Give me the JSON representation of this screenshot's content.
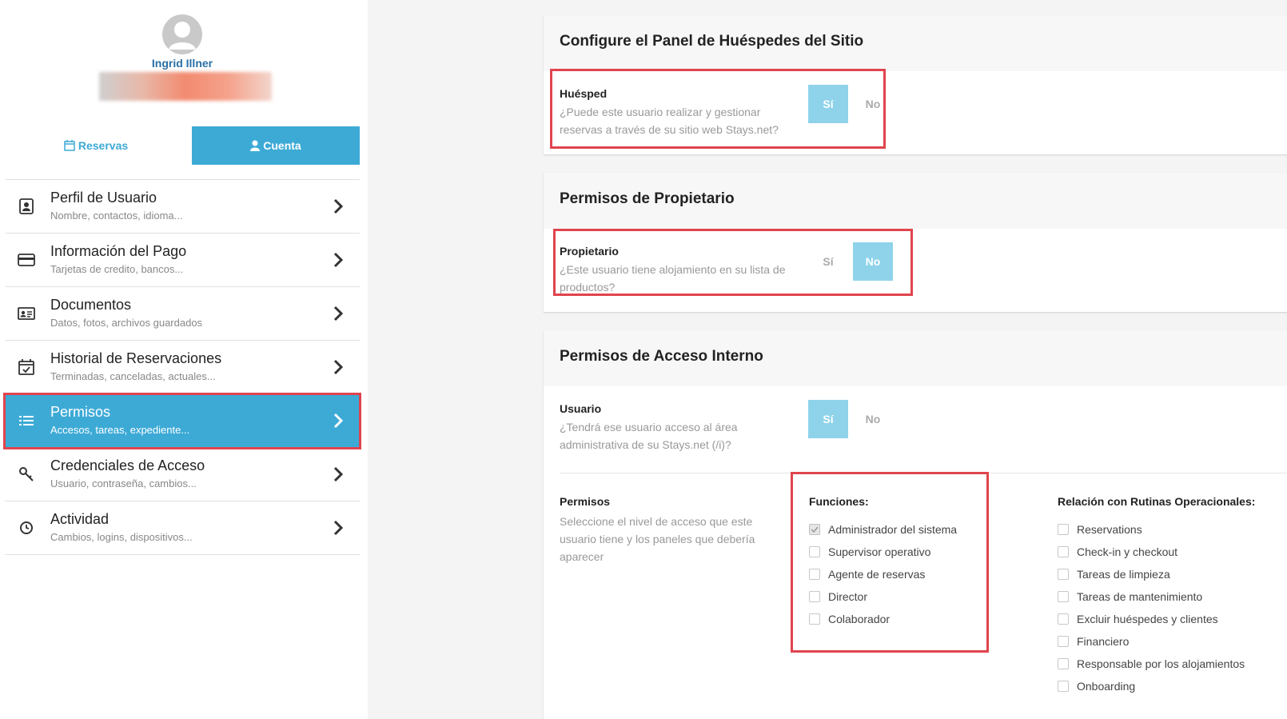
{
  "profile": {
    "name": "Ingrid Illner"
  },
  "tabs": {
    "reservas": "Reservas",
    "cuenta": "Cuenta"
  },
  "menu": [
    {
      "title": "Perfil de Usuario",
      "sub": "Nombre, contactos, idioma..."
    },
    {
      "title": "Información del Pago",
      "sub": "Tarjetas de credito, bancos..."
    },
    {
      "title": "Documentos",
      "sub": "Datos, fotos, archivos guardados"
    },
    {
      "title": "Historial de Reservaciones",
      "sub": "Terminadas, canceladas, actuales..."
    },
    {
      "title": "Permisos",
      "sub": "Accesos, tareas, expediente..."
    },
    {
      "title": "Credenciales de Acceso",
      "sub": "Usuario, contraseña, cambios..."
    },
    {
      "title": "Actividad",
      "sub": "Cambios, logins, dispositivos..."
    }
  ],
  "guest_panel": {
    "title": "Configure el Panel de Huéspedes del Sitio",
    "label": "Huésped",
    "desc": "¿Puede este usuario realizar y gestionar reservas a través de su sitio web Stays.net?",
    "yes": "Sí",
    "no": "No",
    "selected": "yes"
  },
  "owner_panel": {
    "title": "Permisos de Propietario",
    "label": "Propietario",
    "desc": "¿Este usuario tiene alojamiento en su lista de productos?",
    "yes": "Sí",
    "no": "No",
    "selected": "no"
  },
  "internal_panel": {
    "title": "Permisos de Acceso Interno",
    "label": "Usuario",
    "desc": "¿Tendrá ese usuario acceso al área administrativa de su Stays.net (/i)?",
    "yes": "Sí",
    "no": "No",
    "selected": "yes",
    "permisos_label": "Permisos",
    "permisos_desc": "Seleccione el nivel de acceso que este usuario tiene y los paneles que debería aparecer",
    "funciones_title": "Funciones:",
    "funciones": [
      {
        "label": "Administrador del sistema",
        "checked": true
      },
      {
        "label": "Supervisor operativo",
        "checked": false
      },
      {
        "label": "Agente de reservas",
        "checked": false
      },
      {
        "label": "Director",
        "checked": false
      },
      {
        "label": "Colaborador",
        "checked": false
      }
    ],
    "rutinas_title": "Relación con Rutinas Operacionales:",
    "rutinas": [
      {
        "label": "Reservations",
        "checked": false
      },
      {
        "label": "Check-in y checkout",
        "checked": false
      },
      {
        "label": "Tareas de limpieza",
        "checked": false
      },
      {
        "label": "Tareas de mantenimiento",
        "checked": false
      },
      {
        "label": "Excluir huéspedes y clientes",
        "checked": false
      },
      {
        "label": "Financiero",
        "checked": false
      },
      {
        "label": "Responsable por los alojamientos",
        "checked": false
      },
      {
        "label": "Onboarding",
        "checked": false
      }
    ]
  },
  "colors": {
    "accent": "#3daad6",
    "toggle_on": "#8ed3ea",
    "highlight": "#e0444e"
  }
}
